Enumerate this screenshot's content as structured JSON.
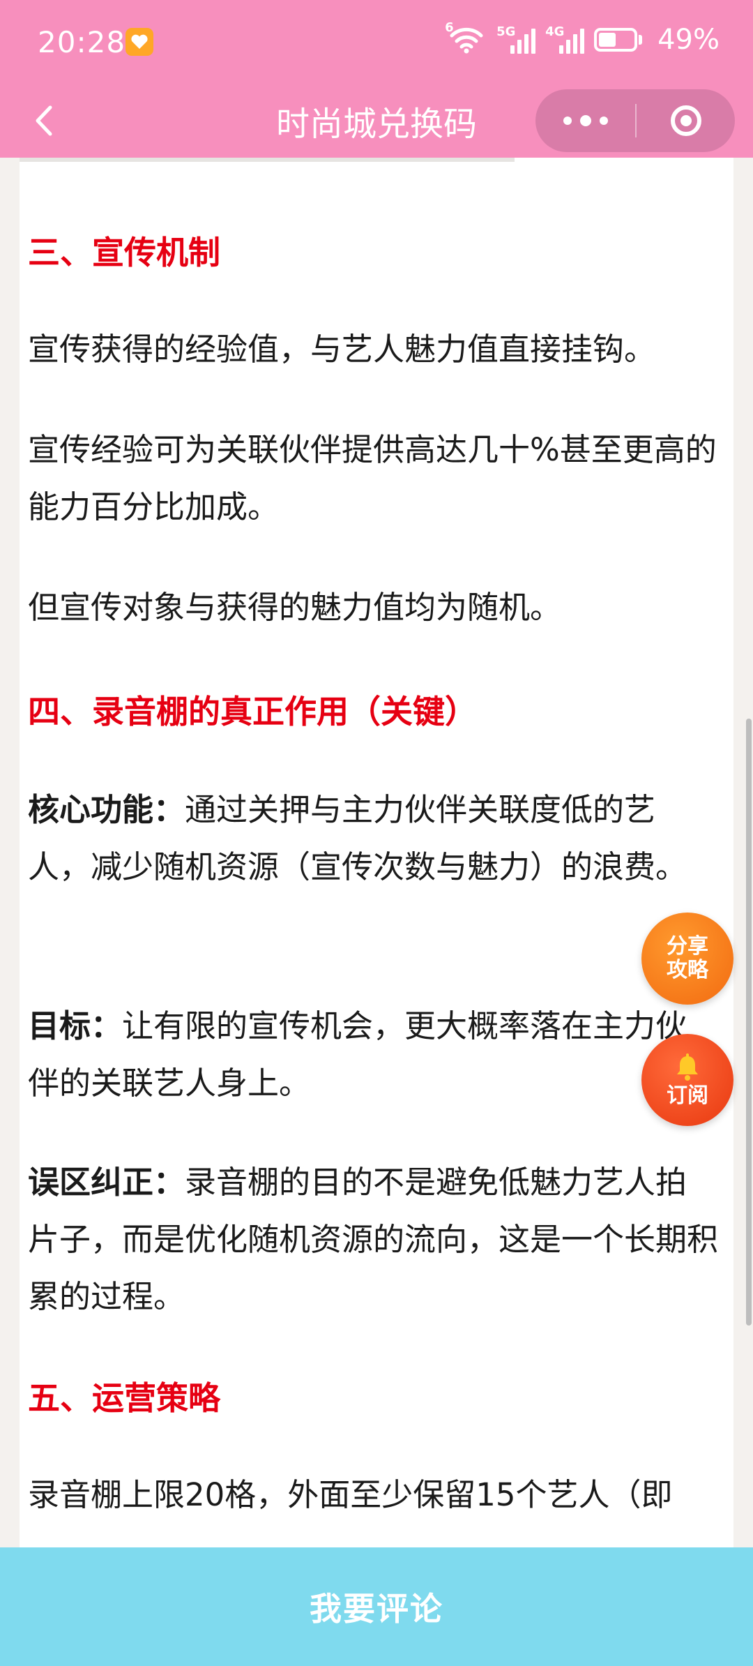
{
  "status": {
    "time": "20:28",
    "wifi_label": "6",
    "signal1_label": "5G",
    "signal2_label": "4G",
    "battery_percent": "49%",
    "battery_level": 0.49
  },
  "nav": {
    "title": "时尚城兑换码"
  },
  "article": {
    "s3_title": "三、宣传机制",
    "s3_p1": "宣传获得的经验值，与艺人魅力值直接挂钩。",
    "s3_p2": "宣传经验可为关联伙伴提供高达几十%甚至更高的能力百分比加成。",
    "s3_p3": "但宣传对象与获得的魅力值均为随机。",
    "s4_title": "四、录音棚的真正作用（关键）",
    "s4_p1_label": "核心功能：",
    "s4_p1_text": "通过关押与主力伙伴关联度低的艺人，减少随机资源（宣传次数与魅力）的浪费。",
    "s4_p2_label": "目标：",
    "s4_p2_text": "让有限的宣传机会，更大概率落在主力伙伴的关联艺人身上。",
    "s4_p3_label": "误区纠正：",
    "s4_p3_text": "录音棚的目的不是避免低魅力艺人拍片子，而是优化随机资源的流向，这是一个长期积累的过程。",
    "s5_title": "五、运营策略",
    "s5_p1": "录音棚上限20格，外面至少保留15个艺人（即"
  },
  "fab": {
    "share_line1": "分享",
    "share_line2": "攻略",
    "subscribe_label": "订阅"
  },
  "footer": {
    "comment_label": "我要评论"
  },
  "colors": {
    "header": "#f78fbd",
    "section_title": "#e60012",
    "fab": "#f47a1c",
    "footer": "#7fdaee"
  }
}
